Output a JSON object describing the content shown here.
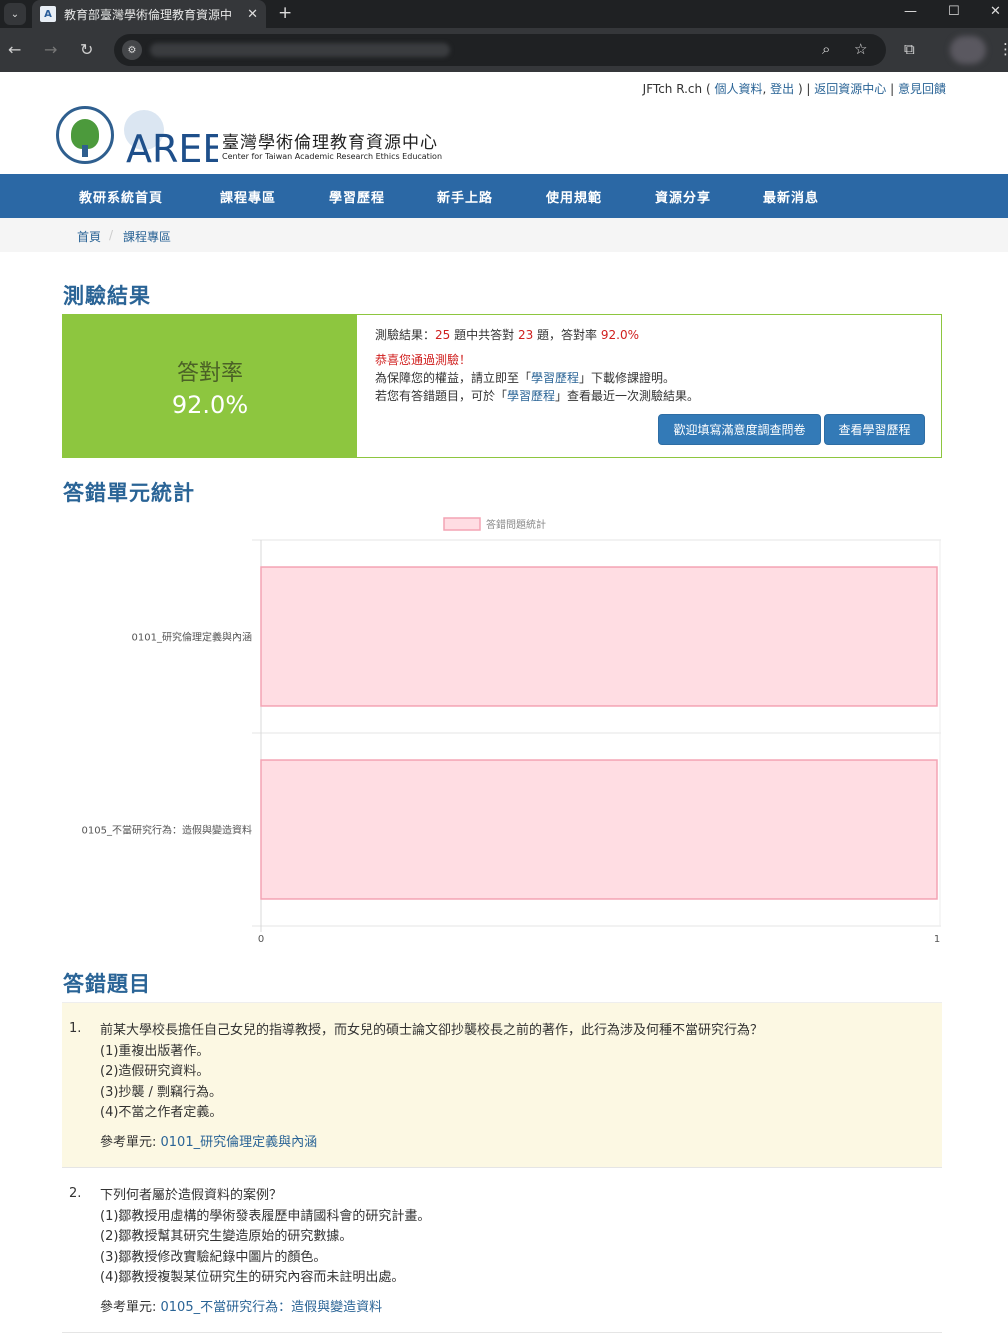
{
  "browser": {
    "tab_title": "教育部臺灣學術倫理教育資源中",
    "tab_close": "✕",
    "new_tab": "+",
    "win_min": "—",
    "win_max": "☐",
    "win_close": "✕"
  },
  "userbar": {
    "name": "JFTch R.ch",
    "open": " ( ",
    "profile": "個人資料",
    "comma": ", ",
    "logout": "登出",
    "close": " ) | ",
    "return": "返回資源中心",
    "sep": " | ",
    "feedback": "意見回饋"
  },
  "logo": {
    "letters": "AREE",
    "name": "臺灣學術倫理教育資源中心",
    "subtitle": "Center for Taiwan Academic Research Ethics Education"
  },
  "nav": [
    "教研系統首頁",
    "課程專區",
    "學習歷程",
    "新手上路",
    "使用規範",
    "資源分享",
    "最新消息"
  ],
  "breadcrumb": {
    "home": "首頁",
    "sep": "/",
    "current": "課程專區"
  },
  "result": {
    "heading": "測驗結果",
    "rate_label": "答對率",
    "rate_value": "92.0%",
    "summary_prefix": "測驗結果：",
    "total": "25",
    "mid": " 題中共答對 ",
    "correct": "23",
    "mid2": " 題，答對率 ",
    "percent": "92.0%",
    "congrats": "恭喜您通過測驗！",
    "line2_a": "為保障您的權益，請立即至「",
    "line2_link": "學習歷程",
    "line2_b": "」下載修課證明。",
    "line3_a": "若您有答錯題目，可於「",
    "line3_link": "學習歷程",
    "line3_b": "」查看最近一次測驗結果。",
    "btn_survey": "歡迎填寫滿意度調查問卷",
    "btn_history": "查看學習歷程"
  },
  "stats_heading": "答錯單元統計",
  "chart_data": {
    "type": "bar",
    "orientation": "horizontal",
    "categories": [
      "0101_研究倫理定義與內涵",
      "0105_不當研究行為：造假與變造資料"
    ],
    "series": [
      {
        "name": "答錯問題統計",
        "values": [
          1,
          1
        ]
      }
    ],
    "xlim": [
      0,
      1
    ],
    "x_ticks": [
      "0",
      "1"
    ],
    "legend": "top",
    "grid": true,
    "colors": {
      "fill": "#ffdde3",
      "stroke": "#f4a3b4"
    }
  },
  "wrong_heading": "答錯題目",
  "questions": [
    {
      "num": "1.",
      "text": "前某大學校長擔任自己女兒的指導教授，而女兒的碩士論文卻抄襲校長之前的著作，此行為涉及何種不當研究行為？",
      "options": [
        "(1)重複出版著作。",
        "(2)造假研究資料。",
        "(3)抄襲 / 剽竊行為。",
        "(4)不當之作者定義。"
      ],
      "ref_label": "參考單元: ",
      "ref_link": "0101_研究倫理定義與內涵"
    },
    {
      "num": "2.",
      "text": "下列何者屬於造假資料的案例？",
      "options": [
        "(1)鄒教授用虛構的學術發表履歷申請國科會的研究計畫。",
        "(2)鄒教授幫其研究生變造原始的研究數據。",
        "(3)鄒教授修改實驗紀錄中圖片的顏色。",
        "(4)鄒教授複製某位研究生的研究內容而未註明出處。"
      ],
      "ref_label": "參考單元: ",
      "ref_link": "0105_不當研究行為：造假與變造資料"
    }
  ]
}
